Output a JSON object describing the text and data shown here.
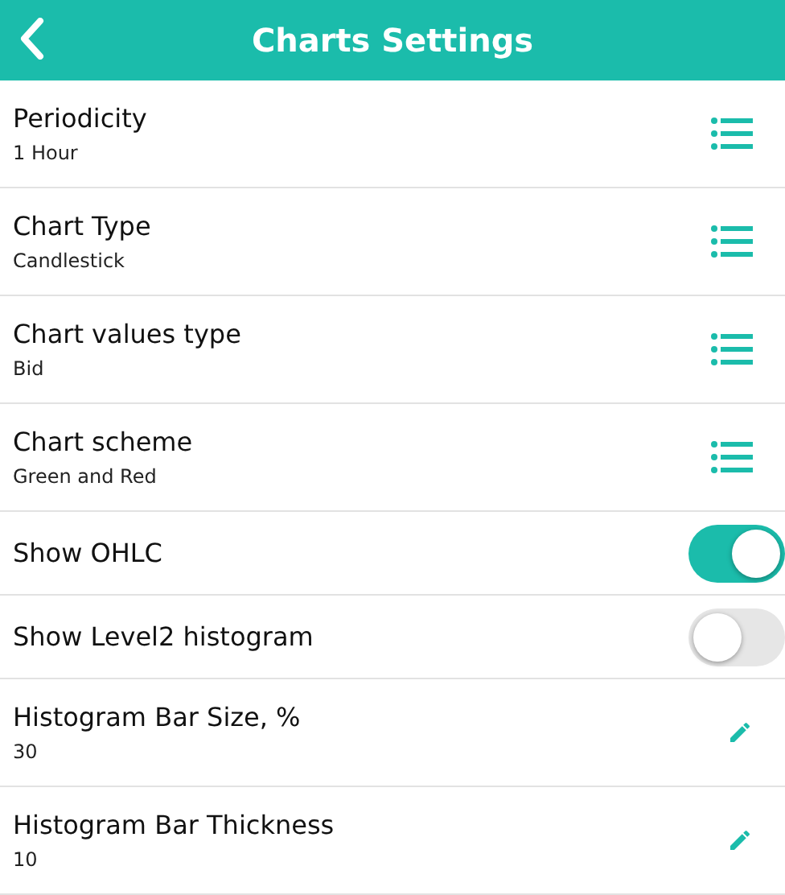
{
  "header": {
    "title": "Charts Settings"
  },
  "settings": [
    {
      "kind": "list",
      "label": "Periodicity",
      "value": "1 Hour"
    },
    {
      "kind": "list",
      "label": "Chart Type",
      "value": "Candlestick"
    },
    {
      "kind": "list",
      "label": "Chart values type",
      "value": "Bid"
    },
    {
      "kind": "list",
      "label": "Chart scheme",
      "value": "Green and Red"
    },
    {
      "kind": "toggle",
      "label": "Show OHLC",
      "on": true
    },
    {
      "kind": "toggle",
      "label": "Show Level2 histogram",
      "on": false
    },
    {
      "kind": "edit",
      "label": "Histogram Bar Size, %",
      "value": "30"
    },
    {
      "kind": "edit",
      "label": "Histogram Bar Thickness",
      "value": "10"
    }
  ]
}
